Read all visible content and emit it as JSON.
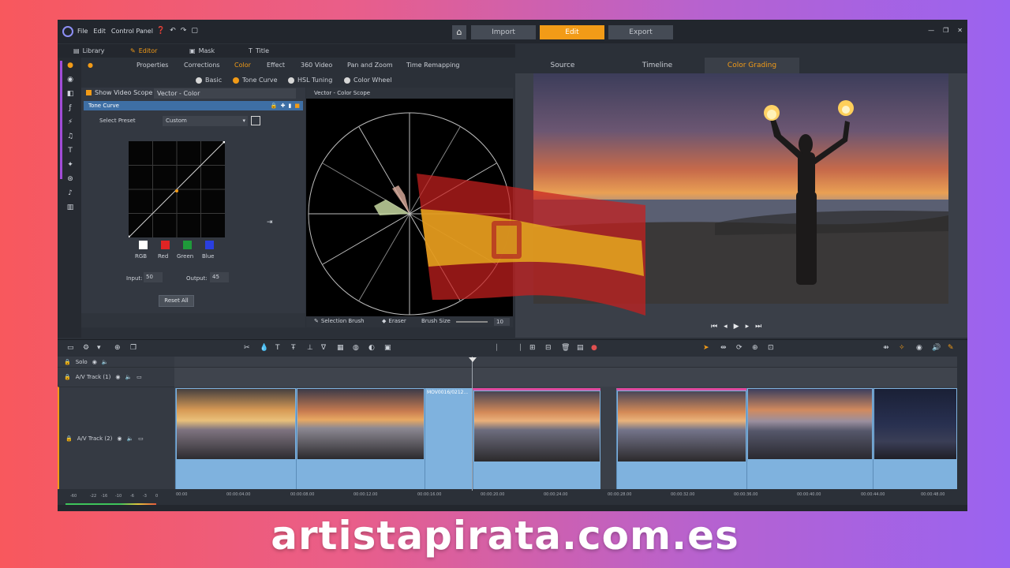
{
  "menu": [
    "File",
    "Edit",
    "Control Panel"
  ],
  "modes": [
    {
      "label": "Import",
      "active": false
    },
    {
      "label": "Edit",
      "active": true
    },
    {
      "label": "Export",
      "active": false
    }
  ],
  "subtabs": [
    {
      "label": "Library",
      "active": false
    },
    {
      "label": "Editor",
      "active": true
    },
    {
      "label": "Mask",
      "active": false
    },
    {
      "label": "Title",
      "active": false
    }
  ],
  "editor_tabs": [
    "Properties",
    "Corrections",
    "Color",
    "Effect",
    "360 Video",
    "Pan and Zoom",
    "Time Remapping"
  ],
  "editor_tab_active": "Color",
  "color_tabs": [
    {
      "label": "Basic",
      "active": false
    },
    {
      "label": "Tone Curve",
      "active": true
    },
    {
      "label": "HSL Tuning",
      "active": false
    },
    {
      "label": "Color Wheel",
      "active": false
    }
  ],
  "scope": {
    "show_label": "Show Video Scope",
    "type": "Vector - Color",
    "panel_title": "Vector - Color Scope",
    "tools": {
      "selection_brush": "Selection Brush",
      "eraser": "Eraser",
      "brush_size_label": "Brush Size",
      "brush_size": "10"
    }
  },
  "tone_curve": {
    "header": "Tone Curve",
    "preset_label": "Select Preset",
    "preset_value": "Custom",
    "channels": [
      {
        "label": "RGB",
        "color": "#ffffff"
      },
      {
        "label": "Red",
        "color": "#e02424"
      },
      {
        "label": "Green",
        "color": "#1f9a3a"
      },
      {
        "label": "Blue",
        "color": "#2a3fe0"
      }
    ],
    "input_label": "Input:",
    "input_value": "50",
    "output_label": "Output:",
    "output_value": "45",
    "reset_label": "Reset All"
  },
  "preview_tabs": [
    {
      "label": "Source",
      "active": false
    },
    {
      "label": "Timeline",
      "active": false
    },
    {
      "label": "Color Grading",
      "active": true
    }
  ],
  "timeline": {
    "solo_label": "Solo",
    "tracks": [
      {
        "label": "A/V Track (1)"
      },
      {
        "label": "A/V Track (2)"
      }
    ],
    "clip_label": "MOV0016/0212...",
    "timecodes": [
      "00:00",
      "00:00:04.00",
      "00:00:08.00",
      "00:00:12.00",
      "00:00:16.00",
      "00:00:20.00",
      "00:00:24.00",
      "00:00:28.00",
      "00:00:32.00",
      "00:00:36.00",
      "00:00:40.00",
      "00:00:44.00",
      "00:00:48.00"
    ],
    "meter_labels": [
      "-60",
      "-22",
      "-16",
      "-10",
      "-6",
      "-3",
      "0"
    ]
  },
  "accent_color": "#f29b17",
  "watermark": "artistapirata.com.es"
}
